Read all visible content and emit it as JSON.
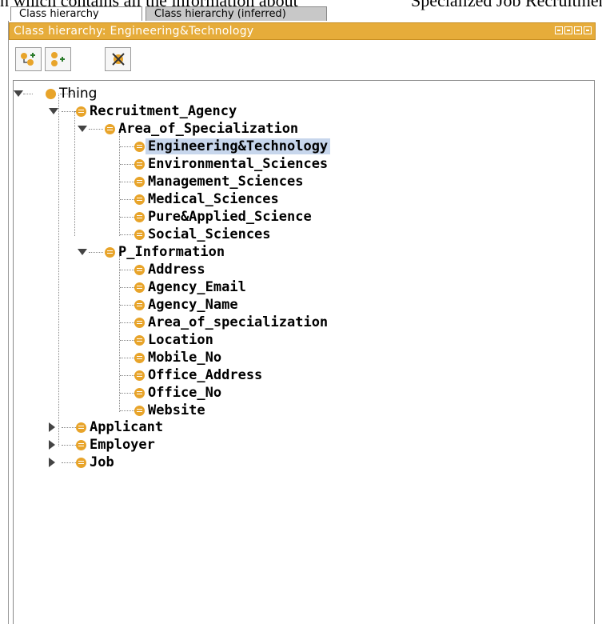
{
  "caption": {
    "left": "n which contains all the information about",
    "right": "Specialized Job Recruitment"
  },
  "tabs": [
    {
      "label": "Class hierarchy",
      "active": true
    },
    {
      "label": "Class hierarchy (inferred)",
      "active": false
    }
  ],
  "panel": {
    "title": "Class hierarchy: Engineering&Technology",
    "accent": "#e6ac3a"
  },
  "toolbar": {
    "add_subclass_icon": "add-subclass-icon",
    "add_sibling_icon": "add-sibling-icon",
    "delete_class_icon": "delete-class-icon"
  },
  "tree": {
    "thing": "Thing",
    "recruitment_agency": "Recruitment_Agency",
    "area_of_specialization": "Area_of_Specialization",
    "area_children": [
      "Engineering&Technology",
      "Environmental_Sciences",
      "Management_Sciences",
      "Medical_Sciences",
      "Pure&Applied_Science",
      "Social_Sciences"
    ],
    "p_information": "P_Information",
    "p_children": [
      "Address",
      "Agency_Email",
      "Agency_Name",
      "Area_of_specialization",
      "Location",
      "Mobile_No",
      "Office_Address",
      "Office_No",
      "Website"
    ],
    "applicant": "Applicant",
    "employer": "Employer",
    "job": "Job",
    "selected": "Engineering&Technology",
    "selection_color": "#c7d6ec"
  }
}
